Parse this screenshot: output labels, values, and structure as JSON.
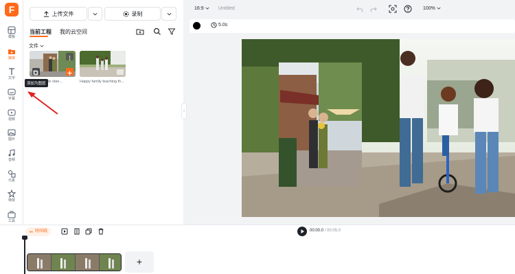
{
  "app": {
    "logo_letter": "F",
    "accent_color": "#ff6a1a"
  },
  "rail": {
    "items": [
      {
        "label": "模板",
        "icon": "template-icon"
      },
      {
        "label": "媒体",
        "icon": "media-icon"
      },
      {
        "label": "文字",
        "icon": "text-icon"
      },
      {
        "label": "字幕",
        "icon": "subtitle-icon"
      },
      {
        "label": "视频",
        "icon": "video-icon"
      },
      {
        "label": "图片",
        "icon": "image-icon"
      },
      {
        "label": "音频",
        "icon": "audio-icon"
      },
      {
        "label": "元素",
        "icon": "elements-icon"
      },
      {
        "label": "特效",
        "icon": "effects-icon"
      },
      {
        "label": "工具",
        "icon": "tools-icon"
      }
    ]
  },
  "panel": {
    "upload_label": "上传文件",
    "record_label": "录制",
    "tab_current": "当前工程",
    "tab_cloud": "我的云空间",
    "folder_label": "文件",
    "media": [
      {
        "caption": "Asian couple stan..."
      },
      {
        "caption": "Happy family teaching th..."
      }
    ],
    "tooltip": "添加为图层"
  },
  "toolbar": {
    "aspect": "16:9",
    "title": "Untitled",
    "zoom": "100%",
    "duration": "5.0s"
  },
  "timeline": {
    "label": "时间线",
    "current_time": "00:00.0",
    "total_time": "/ 00:05.0",
    "add_label": "+"
  }
}
